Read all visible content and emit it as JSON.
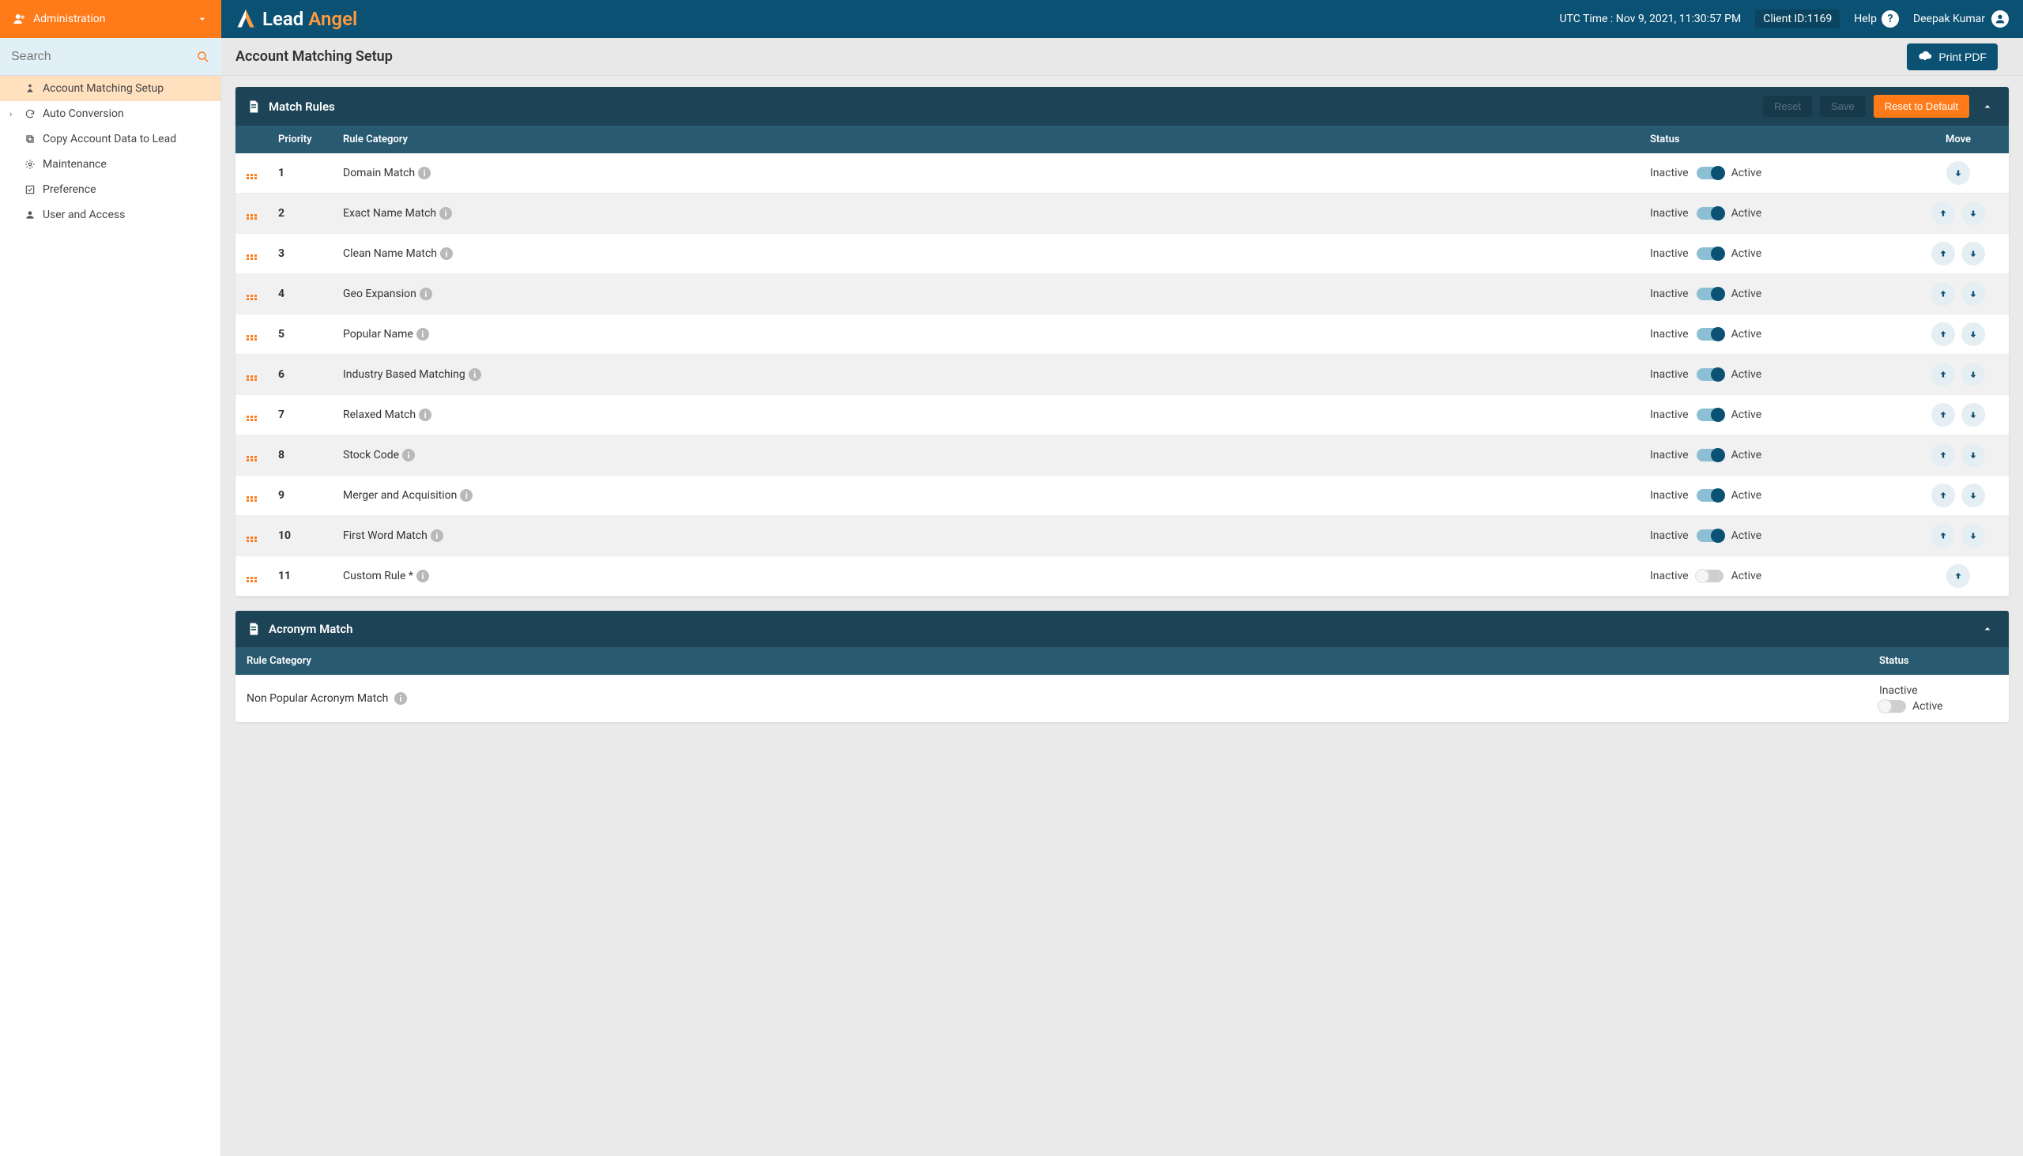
{
  "topbar": {
    "section_label": "Administration",
    "logo_part1": "Lead",
    "logo_part2": "Angel",
    "utc_label": "UTC Time : Nov 9, 2021, 11:30:57 PM",
    "client_id": "Client ID:1169",
    "help_label": "Help",
    "user_name": "Deepak Kumar"
  },
  "search": {
    "placeholder": "Search"
  },
  "page": {
    "title": "Account Matching Setup",
    "print_label": "Print PDF"
  },
  "sidebar": {
    "items": [
      {
        "label": "Account Matching Setup",
        "icon": "setup",
        "active": true
      },
      {
        "label": "Auto Conversion",
        "icon": "refresh",
        "expandable": true
      },
      {
        "label": "Copy Account Data to Lead",
        "icon": "copy"
      },
      {
        "label": "Maintenance",
        "icon": "gear"
      },
      {
        "label": "Preference",
        "icon": "pref"
      },
      {
        "label": "User and Access",
        "icon": "user"
      }
    ]
  },
  "match_rules": {
    "title": "Match Rules",
    "reset_label": "Reset",
    "save_label": "Save",
    "reset_default_label": "Reset to Default",
    "col_priority": "Priority",
    "col_rule": "Rule Category",
    "col_status": "Status",
    "col_move": "Move",
    "inactive_label": "Inactive",
    "active_label": "Active",
    "rows": [
      {
        "priority": "1",
        "name": "Domain Match",
        "active": true,
        "up": false,
        "down": true
      },
      {
        "priority": "2",
        "name": "Exact Name Match",
        "active": true,
        "up": true,
        "down": true
      },
      {
        "priority": "3",
        "name": "Clean Name Match",
        "active": true,
        "up": true,
        "down": true
      },
      {
        "priority": "4",
        "name": "Geo Expansion",
        "active": true,
        "up": true,
        "down": true
      },
      {
        "priority": "5",
        "name": "Popular Name",
        "active": true,
        "up": true,
        "down": true
      },
      {
        "priority": "6",
        "name": "Industry Based Matching",
        "active": true,
        "up": true,
        "down": true
      },
      {
        "priority": "7",
        "name": "Relaxed Match",
        "active": true,
        "up": true,
        "down": true
      },
      {
        "priority": "8",
        "name": "Stock Code",
        "active": true,
        "up": true,
        "down": true
      },
      {
        "priority": "9",
        "name": "Merger and Acquisition",
        "active": true,
        "up": true,
        "down": true
      },
      {
        "priority": "10",
        "name": "First Word Match",
        "active": true,
        "up": true,
        "down": true
      },
      {
        "priority": "11",
        "name": "Custom Rule *",
        "active": false,
        "up": true,
        "down": false
      }
    ]
  },
  "acronym": {
    "title": "Acronym Match",
    "col_rule": "Rule Category",
    "col_status": "Status",
    "row_name": "Non Popular Acronym Match",
    "inactive_label": "Inactive",
    "active_label": "Active",
    "active": false
  }
}
